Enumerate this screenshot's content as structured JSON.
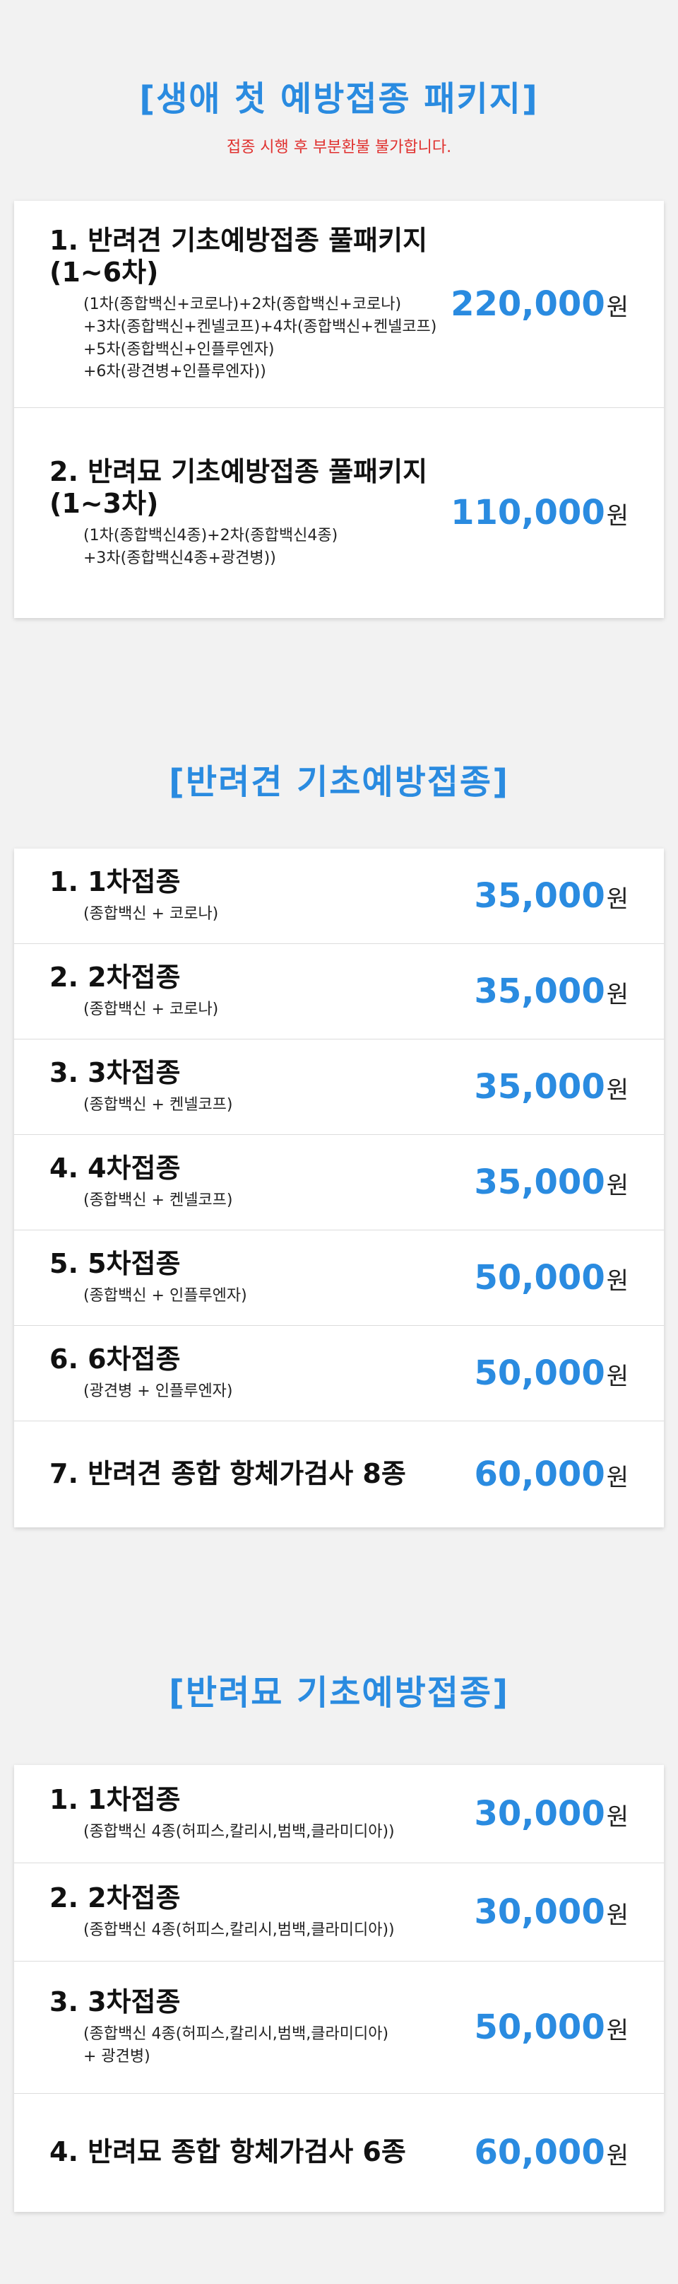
{
  "package": {
    "title": "[생애 첫 예방접종 패키지]",
    "notice": "접종 시행 후 부분환불 불가합니다.",
    "items": [
      {
        "name": "1. 반려견 기초예방접종 풀패키지\n(1~6차)",
        "detail": "(1차(종합백신+코로나)+2차(종합백신+코로나)\n+3차(종합백신+켄넬코프)+4차(종합백신+켄넬코프)\n+5차(종합백신+인플루엔자)\n+6차(광견병+인플루엔자))",
        "price": "220,000",
        "unit": "원"
      },
      {
        "name": "2. 반려묘 기초예방접종 풀패키지\n(1~3차)",
        "detail": "(1차(종합백신4종)+2차(종합백신4종)\n+3차(종합백신4종+광견병))",
        "price": "110,000",
        "unit": "원"
      }
    ]
  },
  "dog": {
    "title": "[반려견 기초예방접종]",
    "items": [
      {
        "name": "1. 1차접종",
        "detail": "(종합백신 + 코로나)",
        "price": "35,000",
        "unit": "원"
      },
      {
        "name": "2. 2차접종",
        "detail": "(종합백신 + 코로나)",
        "price": "35,000",
        "unit": "원"
      },
      {
        "name": "3. 3차접종",
        "detail": "(종합백신 + 켄넬코프)",
        "price": "35,000",
        "unit": "원"
      },
      {
        "name": "4. 4차접종",
        "detail": "(종합백신 + 켄넬코프)",
        "price": "35,000",
        "unit": "원"
      },
      {
        "name": "5. 5차접종",
        "detail": "(종합백신 + 인플루엔자)",
        "price": "50,000",
        "unit": "원"
      },
      {
        "name": "6. 6차접종",
        "detail": "(광견병 + 인플루엔자)",
        "price": "50,000",
        "unit": "원"
      },
      {
        "name": "7. 반려견 종합 항체가검사 8종",
        "detail": "",
        "price": "60,000",
        "unit": "원"
      }
    ]
  },
  "cat": {
    "title": "[반려묘 기초예방접종]",
    "items": [
      {
        "name": "1. 1차접종",
        "detail": "(종합백신 4종(허피스,칼리시,범백,클라미디아))",
        "price": "30,000",
        "unit": "원"
      },
      {
        "name": "2. 2차접종",
        "detail": "(종합백신 4종(허피스,칼리시,범백,클라미디아))",
        "price": "30,000",
        "unit": "원"
      },
      {
        "name": "3. 3차접종",
        "detail": "(종합백신 4종(허피스,칼리시,범백,클라미디아)\n+ 광견병)",
        "price": "50,000",
        "unit": "원"
      },
      {
        "name": "4. 반려묘 종합 항체가검사 6종",
        "detail": "",
        "price": "60,000",
        "unit": "원"
      }
    ]
  }
}
